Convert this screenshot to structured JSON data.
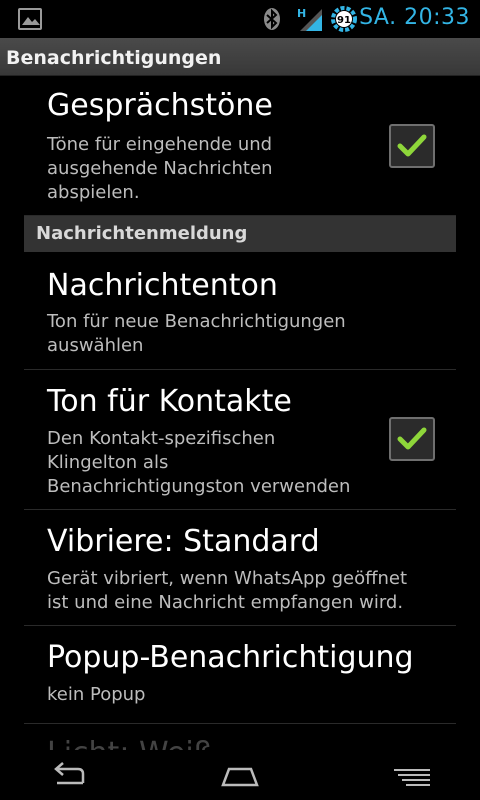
{
  "status_bar": {
    "time": "SA. 20:33",
    "battery_level": "91",
    "network_type": "H",
    "icons": [
      "image-notification-icon",
      "bluetooth-icon",
      "signal-icon",
      "battery-icon"
    ],
    "accent_color": "#33b5e5"
  },
  "header": {
    "title": "Benachrichtigungen"
  },
  "settings": {
    "items": [
      {
        "title": "Gesprächstöne",
        "summary": [
          "Töne für eingehende und",
          "ausgehende Nachrichten",
          "abspielen."
        ],
        "checked": true
      },
      {
        "title": "Nachrichtenton",
        "summary": [
          "Ton für neue Benachrichtigungen",
          "auswählen"
        ]
      },
      {
        "title": "Ton für Kontakte",
        "summary": [
          "Den Kontakt-spezifischen",
          "Klingelton als",
          "Benachrichtigungston verwenden"
        ],
        "checked": true
      },
      {
        "title": "Vibriere: Standard",
        "summary": [
          "Gerät vibriert, wenn WhatsApp geöffnet",
          "ist und eine Nachricht empfangen wird."
        ]
      },
      {
        "title": "Popup-Benachrichtigung",
        "summary": [
          "kein Popup"
        ]
      },
      {
        "title": "Licht: Weiß"
      }
    ],
    "section_header": "Nachrichtenmeldung"
  },
  "nav_bar": {
    "icons": [
      "back-icon",
      "home-icon",
      "recent-apps-icon"
    ]
  }
}
